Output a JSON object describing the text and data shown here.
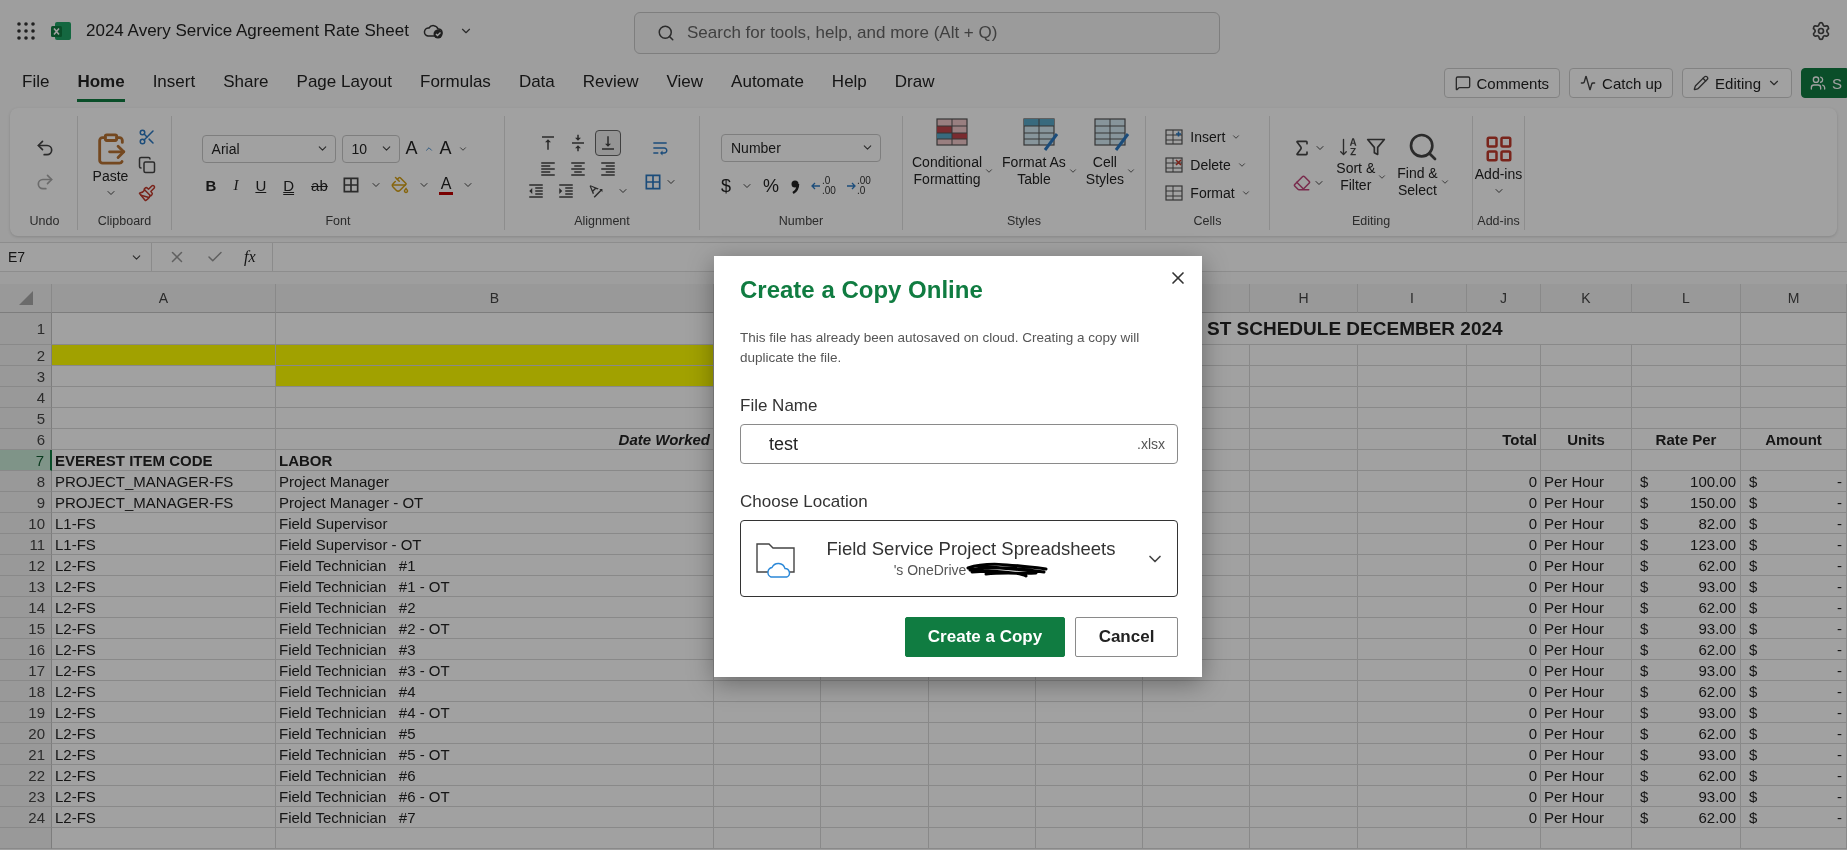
{
  "app": {
    "title": "2024 Avery Service Agreement Rate Sheet",
    "search_placeholder": "Search for tools, help, and more (Alt + Q)"
  },
  "menu_tabs": [
    {
      "label": "File",
      "selected": false
    },
    {
      "label": "Home",
      "selected": true
    },
    {
      "label": "Insert",
      "selected": false
    },
    {
      "label": "Share",
      "selected": false
    },
    {
      "label": "Page Layout",
      "selected": false
    },
    {
      "label": "Formulas",
      "selected": false
    },
    {
      "label": "Data",
      "selected": false
    },
    {
      "label": "Review",
      "selected": false
    },
    {
      "label": "View",
      "selected": false
    },
    {
      "label": "Automate",
      "selected": false
    },
    {
      "label": "Help",
      "selected": false
    },
    {
      "label": "Draw",
      "selected": false
    }
  ],
  "header_buttons": [
    {
      "kind": "comments",
      "label": "Comments"
    },
    {
      "kind": "activity",
      "label": "Catch up"
    },
    {
      "kind": "editing",
      "label": "Editing"
    },
    {
      "kind": "share",
      "label": "S"
    }
  ],
  "ribbon": [
    {
      "kind": "undo",
      "label": "Undo"
    },
    {
      "kind": "clipboard",
      "label": "Clipboard",
      "paste": "Paste"
    },
    {
      "kind": "font",
      "label": "Font",
      "font_name": "Arial",
      "font_size": "10",
      "grow": "A",
      "shrink": "A",
      "style_buttons": [
        "B",
        "I",
        "U",
        "D",
        "ab"
      ],
      "font_color": "A"
    },
    {
      "kind": "alignment",
      "label": "Alignment",
      "vertical_buttons": [
        {
          "selected": false
        },
        {
          "selected": false
        },
        {
          "selected": true
        }
      ]
    },
    {
      "kind": "number",
      "label": "Number",
      "format": "Number",
      "currency": "$",
      "percent": "%",
      "decimals": [
        {
          "top": ".0",
          "bottom": ".00"
        },
        {
          "top": ".00",
          "bottom": ".0"
        }
      ]
    },
    {
      "kind": "styles",
      "label": "Styles",
      "buttons": [
        {
          "lines": [
            "Conditional",
            "Formatting"
          ]
        },
        {
          "lines": [
            "Format As",
            "Table"
          ]
        },
        {
          "lines": [
            "Cell",
            "Styles"
          ]
        }
      ]
    },
    {
      "kind": "cells",
      "label": "Cells",
      "buttons": [
        "Insert",
        "Delete",
        "Format"
      ]
    },
    {
      "kind": "editing",
      "label": "Editing",
      "buttons": [
        {
          "lines": [
            "Sort &",
            "Filter"
          ]
        },
        {
          "lines": [
            "Find &",
            "Select"
          ]
        }
      ]
    },
    {
      "kind": "addins",
      "label": "Add-ins",
      "button": "Add-ins"
    }
  ],
  "formula_bar": {
    "name_box": "E7",
    "function_label": "fx"
  },
  "sheet": {
    "columns": [
      {
        "letter": "A"
      },
      {
        "letter": "B"
      },
      {},
      {},
      {},
      {},
      {},
      {
        "letter": "H"
      },
      {
        "letter": "I"
      },
      {
        "letter": "J"
      },
      {
        "letter": "K"
      },
      {
        "letter": "L"
      },
      {
        "letter": "M"
      }
    ],
    "rows": [
      {
        "number": "1",
        "selected": false,
        "kind": "title",
        "banner": "ST SCHEDULE DECEMBER 2024"
      },
      {
        "number": "2",
        "selected": false,
        "kind": "band"
      },
      {
        "number": "3",
        "selected": false,
        "kind": "inset_band"
      },
      {
        "number": "4",
        "selected": false,
        "kind": "blank"
      },
      {
        "number": "5",
        "selected": false,
        "kind": "blank"
      },
      {
        "number": "6",
        "selected": false,
        "kind": "column_heading",
        "cells": {
          "B": "Date Worked",
          "J": "Total",
          "K": "Units",
          "L": "Rate Per",
          "M": "Amount"
        }
      },
      {
        "number": "7",
        "selected": true,
        "kind": "label_heading",
        "cells": {
          "A": "EVEREST ITEM CODE",
          "B": "LABOR"
        }
      },
      {
        "number": "8",
        "selected": false,
        "kind": "data",
        "cells": {
          "A": "PROJECT_MANAGER-FS",
          "B": "Project Manager",
          "J": "0",
          "K": "Per Hour",
          "L": {
            "currency": "$",
            "value": "100.00"
          },
          "M": {
            "currency": "$",
            "value": "-"
          }
        }
      },
      {
        "number": "9",
        "selected": false,
        "kind": "data",
        "cells": {
          "A": "PROJECT_MANAGER-FS",
          "B": "Project Manager - OT",
          "J": "0",
          "K": "Per Hour",
          "L": {
            "currency": "$",
            "value": "150.00"
          },
          "M": {
            "currency": "$",
            "value": "-"
          }
        }
      },
      {
        "number": "10",
        "selected": false,
        "kind": "data",
        "cells": {
          "A": "L1-FS",
          "B": "Field Supervisor",
          "J": "0",
          "K": "Per Hour",
          "L": {
            "currency": "$",
            "value": "82.00"
          },
          "M": {
            "currency": "$",
            "value": "-"
          }
        }
      },
      {
        "number": "11",
        "selected": false,
        "kind": "data",
        "cells": {
          "A": "L1-FS",
          "B": "Field Supervisor - OT",
          "J": "0",
          "K": "Per Hour",
          "L": {
            "currency": "$",
            "value": "123.00"
          },
          "M": {
            "currency": "$",
            "value": "-"
          }
        }
      },
      {
        "number": "12",
        "selected": false,
        "kind": "data",
        "cells": {
          "A": "L2-FS",
          "B": "Field Technician   #1",
          "J": "0",
          "K": "Per Hour",
          "L": {
            "currency": "$",
            "value": "62.00"
          },
          "M": {
            "currency": "$",
            "value": "-"
          }
        }
      },
      {
        "number": "13",
        "selected": false,
        "kind": "data",
        "cells": {
          "A": "L2-FS",
          "B": "Field Technician   #1 - OT",
          "J": "0",
          "K": "Per Hour",
          "L": {
            "currency": "$",
            "value": "93.00"
          },
          "M": {
            "currency": "$",
            "value": "-"
          }
        }
      },
      {
        "number": "14",
        "selected": false,
        "kind": "data",
        "cells": {
          "A": "L2-FS",
          "B": "Field Technician   #2",
          "J": "0",
          "K": "Per Hour",
          "L": {
            "currency": "$",
            "value": "62.00"
          },
          "M": {
            "currency": "$",
            "value": "-"
          }
        }
      },
      {
        "number": "15",
        "selected": false,
        "kind": "data",
        "cells": {
          "A": "L2-FS",
          "B": "Field Technician   #2 - OT",
          "J": "0",
          "K": "Per Hour",
          "L": {
            "currency": "$",
            "value": "93.00"
          },
          "M": {
            "currency": "$",
            "value": "-"
          }
        }
      },
      {
        "number": "16",
        "selected": false,
        "kind": "data",
        "cells": {
          "A": "L2-FS",
          "B": "Field Technician   #3",
          "J": "0",
          "K": "Per Hour",
          "L": {
            "currency": "$",
            "value": "62.00"
          },
          "M": {
            "currency": "$",
            "value": "-"
          }
        }
      },
      {
        "number": "17",
        "selected": false,
        "kind": "data",
        "cells": {
          "A": "L2-FS",
          "B": "Field Technician   #3 - OT",
          "J": "0",
          "K": "Per Hour",
          "L": {
            "currency": "$",
            "value": "93.00"
          },
          "M": {
            "currency": "$",
            "value": "-"
          }
        }
      },
      {
        "number": "18",
        "selected": false,
        "kind": "data",
        "cells": {
          "A": "L2-FS",
          "B": "Field Technician   #4",
          "J": "0",
          "K": "Per Hour",
          "L": {
            "currency": "$",
            "value": "62.00"
          },
          "M": {
            "currency": "$",
            "value": "-"
          }
        }
      },
      {
        "number": "19",
        "selected": false,
        "kind": "data",
        "cells": {
          "A": "L2-FS",
          "B": "Field Technician   #4 - OT",
          "J": "0",
          "K": "Per Hour",
          "L": {
            "currency": "$",
            "value": "93.00"
          },
          "M": {
            "currency": "$",
            "value": "-"
          }
        }
      },
      {
        "number": "20",
        "selected": false,
        "kind": "data",
        "cells": {
          "A": "L2-FS",
          "B": "Field Technician   #5",
          "J": "0",
          "K": "Per Hour",
          "L": {
            "currency": "$",
            "value": "62.00"
          },
          "M": {
            "currency": "$",
            "value": "-"
          }
        }
      },
      {
        "number": "21",
        "selected": false,
        "kind": "data",
        "cells": {
          "A": "L2-FS",
          "B": "Field Technician   #5 - OT",
          "J": "0",
          "K": "Per Hour",
          "L": {
            "currency": "$",
            "value": "93.00"
          },
          "M": {
            "currency": "$",
            "value": "-"
          }
        }
      },
      {
        "number": "22",
        "selected": false,
        "kind": "data",
        "cells": {
          "A": "L2-FS",
          "B": "Field Technician   #6",
          "J": "0",
          "K": "Per Hour",
          "L": {
            "currency": "$",
            "value": "62.00"
          },
          "M": {
            "currency": "$",
            "value": "-"
          }
        }
      },
      {
        "number": "23",
        "selected": false,
        "kind": "data",
        "cells": {
          "A": "L2-FS",
          "B": "Field Technician   #6 - OT",
          "J": "0",
          "K": "Per Hour",
          "L": {
            "currency": "$",
            "value": "93.00"
          },
          "M": {
            "currency": "$",
            "value": "-"
          }
        }
      },
      {
        "number": "24",
        "selected": false,
        "kind": "data",
        "cells": {
          "A": "L2-FS",
          "B": "Field Technician   #7",
          "J": "0",
          "K": "Per Hour",
          "L": {
            "currency": "$",
            "value": "62.00"
          },
          "M": {
            "currency": "$",
            "value": "-"
          }
        }
      }
    ]
  },
  "dialog": {
    "title": "Create a Copy Online",
    "message": "This file has already been autosaved on cloud. Creating a copy will duplicate the file.",
    "file_label": "File Name",
    "file_value": "test",
    "extension": ".xlsx",
    "location_label": "Choose Location",
    "location_name": "Field Service Project Spreadsheets",
    "location_owner": "'s OneDrive",
    "buttons": [
      {
        "kind": "primary",
        "label": "Create a Copy"
      },
      {
        "kind": "secondary",
        "label": "Cancel"
      }
    ]
  }
}
